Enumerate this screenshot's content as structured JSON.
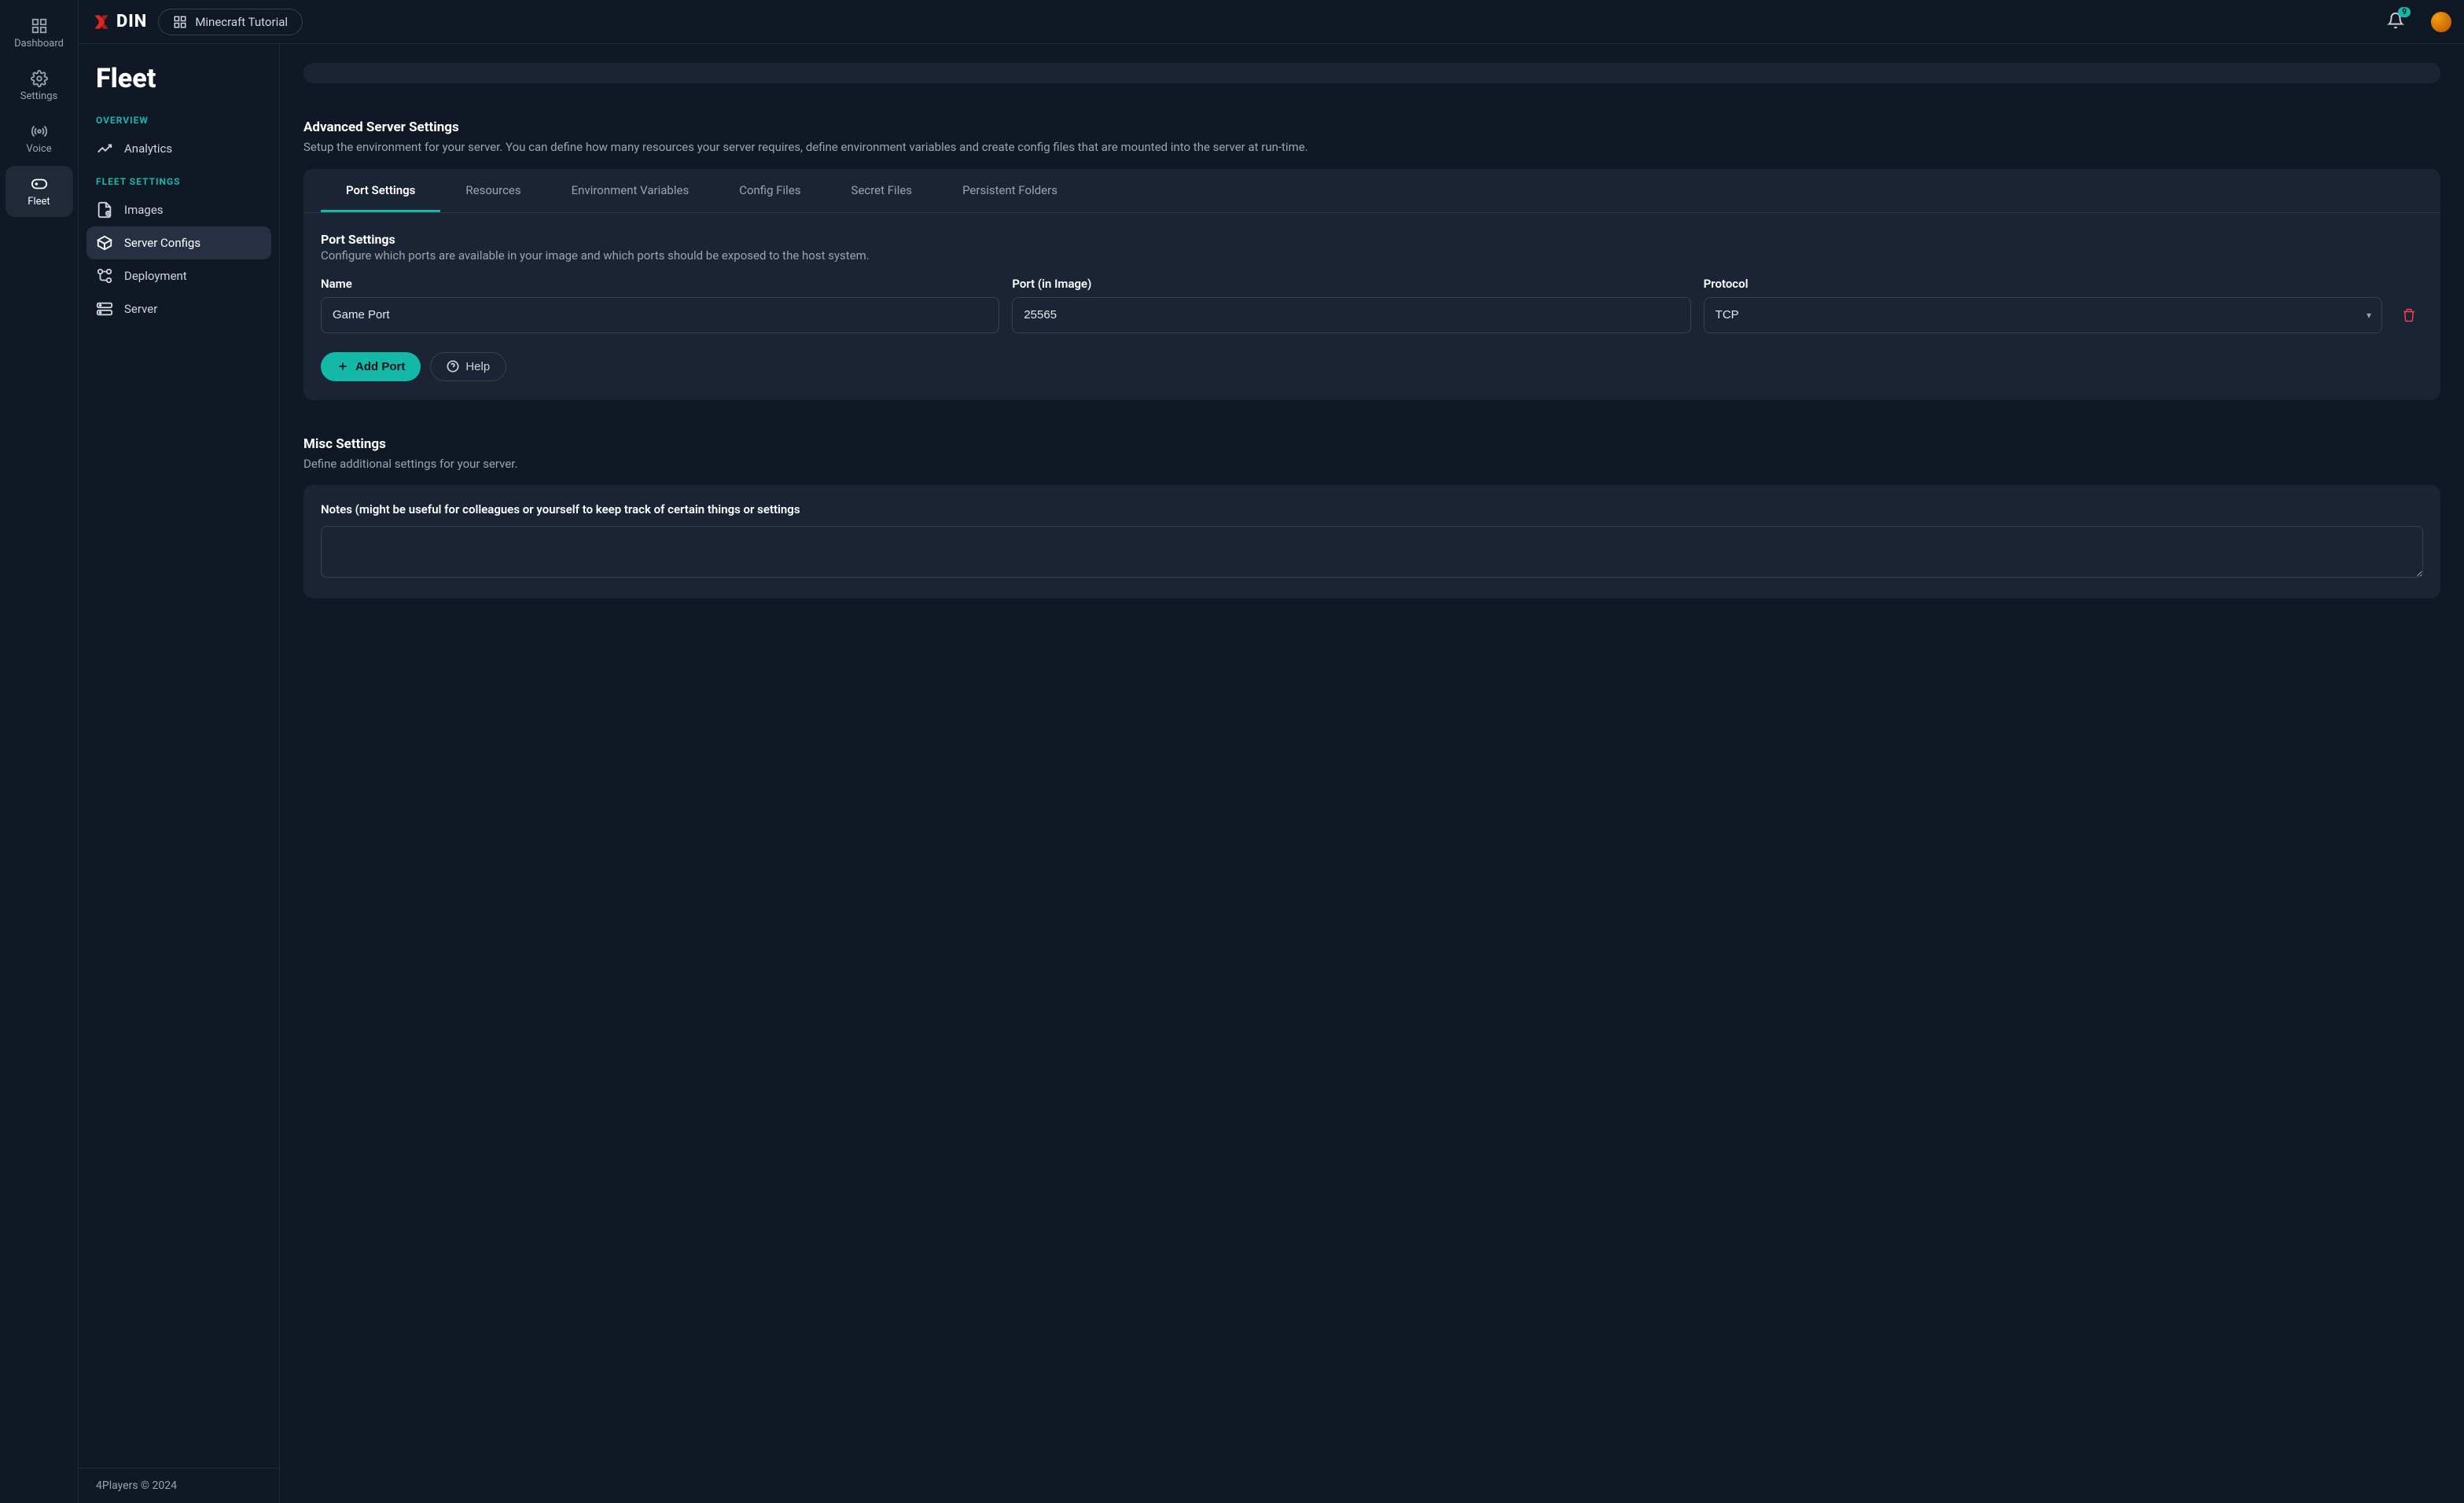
{
  "brand": "DIN",
  "topbar": {
    "tutorial_label": "Minecraft Tutorial",
    "notification_count": "9"
  },
  "rail": {
    "items": [
      {
        "label": "Dashboard"
      },
      {
        "label": "Settings"
      },
      {
        "label": "Voice"
      },
      {
        "label": "Fleet"
      }
    ]
  },
  "sidebar": {
    "title": "Fleet",
    "overview_heading": "OVERVIEW",
    "fleet_settings_heading": "FLEET SETTINGS",
    "items": {
      "analytics": "Analytics",
      "images": "Images",
      "server_configs": "Server Configs",
      "deployment": "Deployment",
      "server": "Server"
    }
  },
  "advanced": {
    "title": "Advanced Server Settings",
    "desc": "Setup the environment for your server. You can define how many resources your server requires, define environment variables and create config files that are mounted into the server at run-time.",
    "tabs": [
      "Port Settings",
      "Resources",
      "Environment Variables",
      "Config Files",
      "Secret Files",
      "Persistent Folders"
    ],
    "port_section": {
      "title": "Port Settings",
      "desc": "Configure which ports are available in your image and which ports should be exposed to the host system.",
      "labels": {
        "name": "Name",
        "port": "Port (in Image)",
        "protocol": "Protocol"
      },
      "row": {
        "name": "Game Port",
        "port": "25565",
        "protocol": "TCP"
      },
      "add_port": "Add Port",
      "help": "Help"
    }
  },
  "misc": {
    "title": "Misc Settings",
    "desc": "Define additional settings for your server.",
    "notes_label": "Notes (might be useful for colleagues or yourself to keep track of certain things or settings",
    "notes_value": ""
  },
  "footer": "4Players © 2024"
}
